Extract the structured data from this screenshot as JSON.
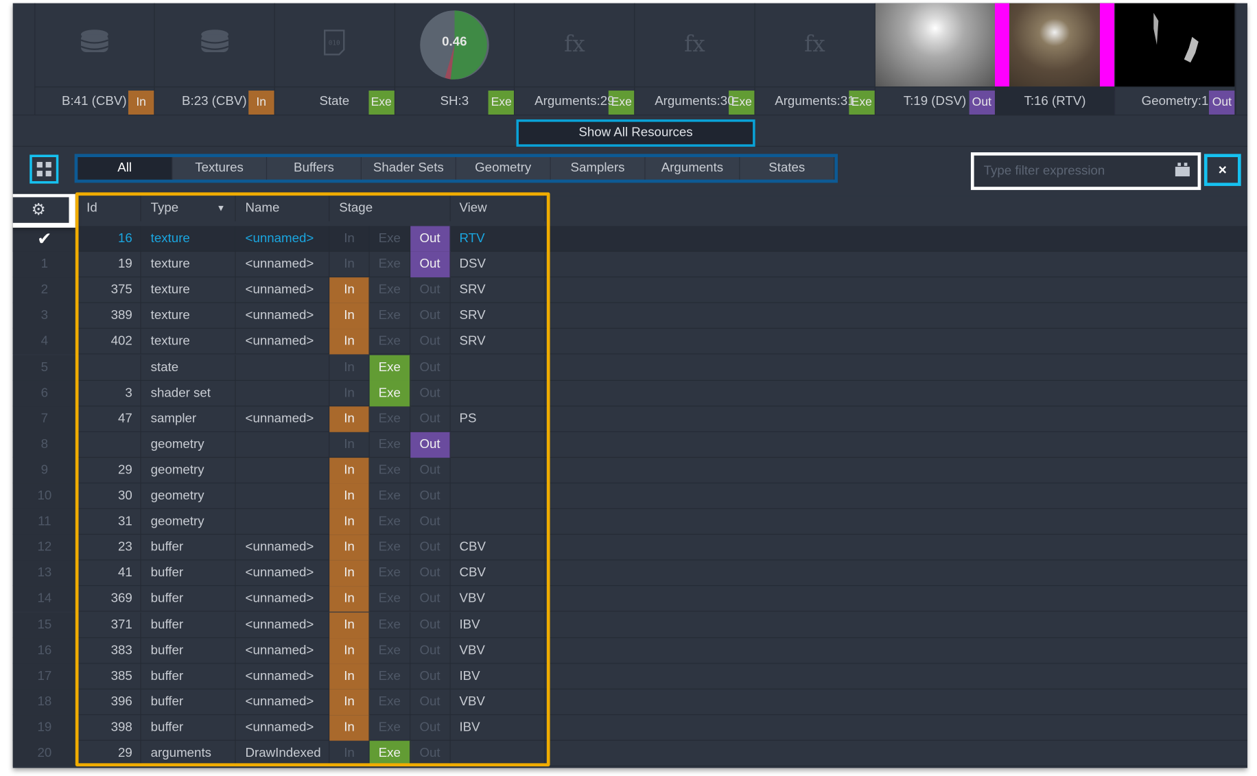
{
  "resources": [
    {
      "label": "B:41 (CBV)",
      "kind": "buffer-icon",
      "stage": "In"
    },
    {
      "label": "B:23 (CBV)",
      "kind": "buffer-icon",
      "stage": "In"
    },
    {
      "label": "State",
      "kind": "state-icon",
      "stage": "Exe"
    },
    {
      "label": "SH:3",
      "kind": "pie-chart",
      "stage": "Exe",
      "pie_value": "0.46"
    },
    {
      "label": "Arguments:29",
      "kind": "fx-icon",
      "stage": "Exe",
      "icon_text": "fx"
    },
    {
      "label": "Arguments:30",
      "kind": "fx-icon",
      "stage": "Exe",
      "icon_text": "fx"
    },
    {
      "label": "Arguments:31",
      "kind": "fx-icon",
      "stage": "Exe",
      "icon_text": "fx"
    },
    {
      "label": "T:19 (DSV)",
      "kind": "depth-thumbnail",
      "stage": "Out"
    },
    {
      "label": "T:16 (RTV)",
      "kind": "color-thumbnail",
      "stage": "Out",
      "selected": true
    },
    {
      "label": "Geometry:1",
      "kind": "geometry-thumbnail",
      "stage": "Out"
    }
  ],
  "show_all_label": "Show All Resources",
  "tabs": [
    "All",
    "Textures",
    "Buffers",
    "Shader Sets",
    "Geometry",
    "Samplers",
    "Arguments",
    "States"
  ],
  "active_tab": "All",
  "filter": {
    "placeholder": "Type filter expression",
    "value": ""
  },
  "clear_label": "×",
  "table": {
    "headers": {
      "id": "Id",
      "type": "Type",
      "name": "Name",
      "stage": "Stage",
      "view": "View"
    },
    "stage_labels": [
      "In",
      "Exe",
      "Out"
    ],
    "rows": [
      {
        "index": "✔",
        "id": "16",
        "type": "texture",
        "name": "<unnamed>",
        "stage": "Out",
        "view": "RTV",
        "selected": true
      },
      {
        "index": "1",
        "id": "19",
        "type": "texture",
        "name": "<unnamed>",
        "stage": "Out",
        "view": "DSV"
      },
      {
        "index": "2",
        "id": "375",
        "type": "texture",
        "name": "<unnamed>",
        "stage": "In",
        "view": "SRV"
      },
      {
        "index": "3",
        "id": "389",
        "type": "texture",
        "name": "<unnamed>",
        "stage": "In",
        "view": "SRV"
      },
      {
        "index": "4",
        "id": "402",
        "type": "texture",
        "name": "<unnamed>",
        "stage": "In",
        "view": "SRV"
      },
      {
        "index": "5",
        "id": "",
        "type": "state",
        "name": "",
        "stage": "Exe",
        "view": ""
      },
      {
        "index": "6",
        "id": "3",
        "type": "shader set",
        "name": "",
        "stage": "Exe",
        "view": ""
      },
      {
        "index": "7",
        "id": "47",
        "type": "sampler",
        "name": "<unnamed>",
        "stage": "In",
        "view": "PS"
      },
      {
        "index": "8",
        "id": "",
        "type": "geometry",
        "name": "",
        "stage": "Out",
        "view": ""
      },
      {
        "index": "9",
        "id": "29",
        "type": "geometry",
        "name": "",
        "stage": "In",
        "view": ""
      },
      {
        "index": "10",
        "id": "30",
        "type": "geometry",
        "name": "",
        "stage": "In",
        "view": ""
      },
      {
        "index": "11",
        "id": "31",
        "type": "geometry",
        "name": "",
        "stage": "In",
        "view": ""
      },
      {
        "index": "12",
        "id": "23",
        "type": "buffer",
        "name": "<unnamed>",
        "stage": "In",
        "view": "CBV"
      },
      {
        "index": "13",
        "id": "41",
        "type": "buffer",
        "name": "<unnamed>",
        "stage": "In",
        "view": "CBV"
      },
      {
        "index": "14",
        "id": "369",
        "type": "buffer",
        "name": "<unnamed>",
        "stage": "In",
        "view": "VBV"
      },
      {
        "index": "15",
        "id": "371",
        "type": "buffer",
        "name": "<unnamed>",
        "stage": "In",
        "view": "IBV"
      },
      {
        "index": "16",
        "id": "383",
        "type": "buffer",
        "name": "<unnamed>",
        "stage": "In",
        "view": "VBV"
      },
      {
        "index": "17",
        "id": "385",
        "type": "buffer",
        "name": "<unnamed>",
        "stage": "In",
        "view": "IBV"
      },
      {
        "index": "18",
        "id": "396",
        "type": "buffer",
        "name": "<unnamed>",
        "stage": "In",
        "view": "VBV"
      },
      {
        "index": "19",
        "id": "398",
        "type": "buffer",
        "name": "<unnamed>",
        "stage": "In",
        "view": "IBV"
      },
      {
        "index": "20",
        "id": "29",
        "type": "arguments",
        "name": "DrawIndexed",
        "stage": "Exe",
        "view": ""
      }
    ]
  },
  "colors": {
    "in": "#a9692c",
    "exe": "#629c34",
    "out": "#6a4b9e",
    "accent": "#16c1f0",
    "highlight": "#f0ac00"
  }
}
